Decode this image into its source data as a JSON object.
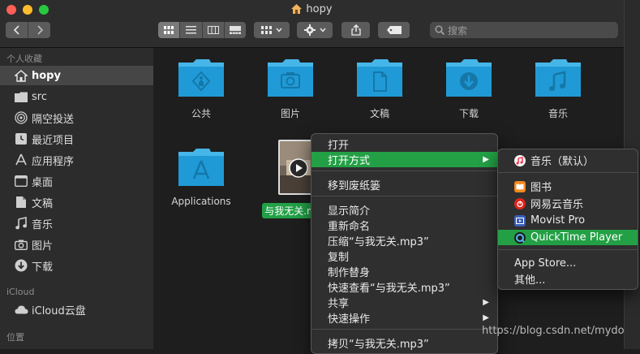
{
  "window": {
    "title": "hopy"
  },
  "toolbar": {
    "back_icon": "chevron-left-icon",
    "forward_icon": "chevron-right-icon",
    "search_placeholder": "搜索"
  },
  "sidebar": {
    "favorites_header": "个人收藏",
    "items": [
      {
        "label": "hopy",
        "icon": "home-icon"
      },
      {
        "label": "src",
        "icon": "folder-icon"
      },
      {
        "label": "隔空投送",
        "icon": "airdrop-icon"
      },
      {
        "label": "最近项目",
        "icon": "clock-icon"
      },
      {
        "label": "应用程序",
        "icon": "applications-icon"
      },
      {
        "label": "桌面",
        "icon": "desktop-icon"
      },
      {
        "label": "文稿",
        "icon": "document-icon"
      },
      {
        "label": "音乐",
        "icon": "music-icon"
      },
      {
        "label": "图片",
        "icon": "camera-icon"
      },
      {
        "label": "下载",
        "icon": "download-icon"
      }
    ],
    "icloud_header": "iCloud",
    "icloud_items": [
      {
        "label": "iCloud云盘",
        "icon": "cloud-icon"
      }
    ],
    "locations_header": "位置"
  },
  "content": {
    "folders": [
      {
        "label": "公共",
        "icon": "public-folder-icon"
      },
      {
        "label": "图片",
        "icon": "pictures-folder-icon"
      },
      {
        "label": "文稿",
        "icon": "documents-folder-icon"
      },
      {
        "label": "下载",
        "icon": "downloads-folder-icon"
      },
      {
        "label": "音乐",
        "icon": "music-folder-icon"
      },
      {
        "label": "Applications",
        "icon": "applications-folder-icon"
      }
    ],
    "selected_file": {
      "label": "与我无关.m",
      "icon": "mp3-file-icon"
    }
  },
  "context_menu": {
    "open": "打开",
    "open_with": "打开方式",
    "move_to_trash": "移到废纸篓",
    "get_info": "显示简介",
    "rename": "重新命名",
    "compress": "压缩“与我无关.mp3”",
    "duplicate": "复制",
    "make_alias": "制作替身",
    "quick_look": "快速查看“与我无关.mp3”",
    "share": "共享",
    "quick_actions": "快速操作",
    "copy": "拷贝“与我无关.mp3”"
  },
  "open_with_menu": {
    "default_app": "音乐（默认）",
    "apps": [
      "图书",
      "网易云音乐",
      "Movist Pro",
      "QuickTime Player"
    ],
    "app_store": "App Store...",
    "other": "其他..."
  },
  "watermark": "https://blog.csdn.net/mydo",
  "colors": {
    "highlight": "#23a045",
    "folder": "#1f9ad6",
    "folder_tab": "#46b6e8"
  }
}
